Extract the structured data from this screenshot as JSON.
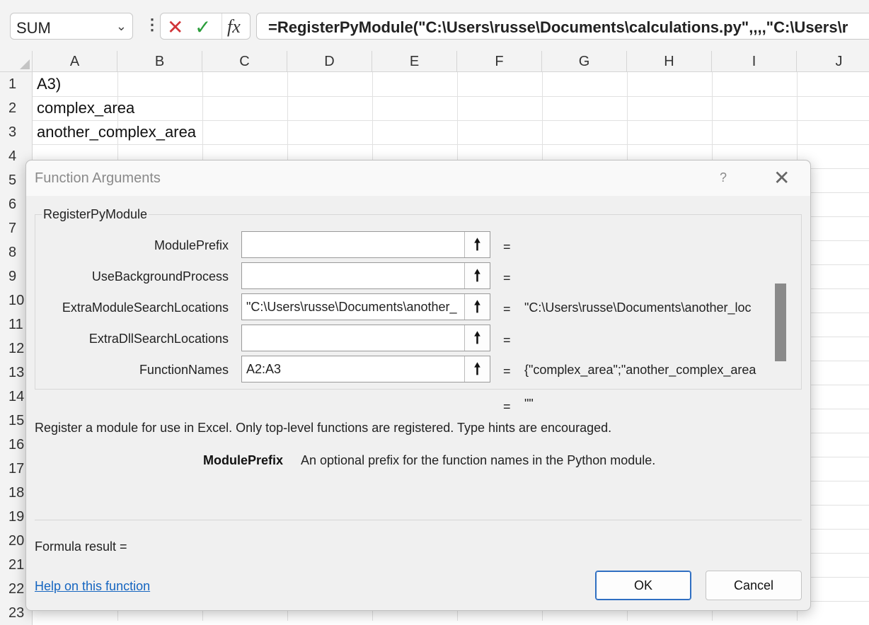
{
  "formula_bar": {
    "name_box": "SUM",
    "name_box_chevron": "chevron-down-icon",
    "more_icon": "⋮",
    "cancel_glyph": "✕",
    "enter_glyph": "✓",
    "fx_label": "fx",
    "formula": "=RegisterPyModule(\"C:\\Users\\russe\\Documents\\calculations.py\",,,,\"C:\\Users\\r"
  },
  "columns": [
    "A",
    "B",
    "C",
    "D",
    "E",
    "F",
    "G",
    "H",
    "I",
    "J"
  ],
  "rows": [
    "1",
    "2",
    "3",
    "4",
    "5",
    "6",
    "7",
    "8",
    "9",
    "10",
    "11",
    "12",
    "13",
    "14",
    "15",
    "16",
    "17",
    "18",
    "19",
    "20",
    "21",
    "22",
    "23"
  ],
  "cells": {
    "A1": "A3)",
    "A2": "complex_area",
    "A3": "another_complex_area"
  },
  "dialog": {
    "title": "Function Arguments",
    "help": "?",
    "close": "✕",
    "function_name": "RegisterPyModule",
    "args": [
      {
        "label": "ModulePrefix",
        "input": "",
        "equals": "=",
        "value": ""
      },
      {
        "label": "UseBackgroundProcess",
        "input": "",
        "equals": "=",
        "value": ""
      },
      {
        "label": "ExtraModuleSearchLocations",
        "input": "\"C:\\Users\\russe\\Documents\\another_",
        "equals": "=",
        "value": "\"C:\\Users\\russe\\Documents\\another_loc"
      },
      {
        "label": "ExtraDllSearchLocations",
        "input": "",
        "equals": "=",
        "value": ""
      },
      {
        "label": "FunctionNames",
        "input": "A2:A3",
        "equals": "=",
        "value": "{\"complex_area\";\"another_complex_area"
      }
    ],
    "collapse_glyph": "🠕",
    "result_equals": "=",
    "result_value": "\"\"",
    "description": "Register a module for use in Excel. Only top-level functions are registered. Type hints are encouraged.",
    "param_name": "ModulePrefix",
    "param_description": "An optional prefix for the function names in the Python module.",
    "formula_result": "Formula result =",
    "help_link": "Help on this function",
    "ok": "OK",
    "cancel": "Cancel"
  },
  "colors": {
    "link": "#1565c0",
    "cancel_red": "#d13438",
    "enter_green": "#2a9d3a",
    "ok_border": "#2f6fc2"
  }
}
